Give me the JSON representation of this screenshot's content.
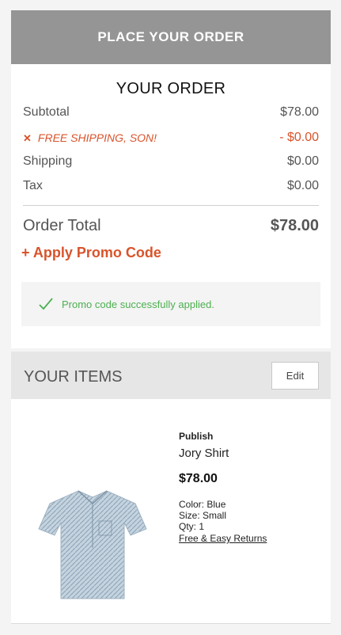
{
  "place_order": {
    "label": "PLACE YOUR ORDER"
  },
  "order": {
    "title": "YOUR ORDER",
    "subtotal_label": "Subtotal",
    "subtotal_value": "$78.00",
    "discount_label": "FREE SHIPPING, SON!",
    "discount_value": "- $0.00",
    "shipping_label": "Shipping",
    "shipping_value": "$0.00",
    "tax_label": "Tax",
    "tax_value": "$0.00",
    "total_label": "Order Total",
    "total_value": "$78.00",
    "promo_link": "+ Apply Promo Code",
    "promo_message": "Promo code successfully applied."
  },
  "items": {
    "title": "YOUR ITEMS",
    "edit_label": "Edit",
    "list": [
      {
        "brand": "Publish",
        "name": "Jory Shirt",
        "price": "$78.00",
        "color": "Color: Blue",
        "size": "Size: Small",
        "qty": "Qty: 1",
        "returns": "Free & Easy Returns",
        "image_icon": "shirt-image"
      }
    ]
  },
  "colors": {
    "accent": "#d9532b",
    "success": "#4caf50",
    "button": "#959595"
  }
}
